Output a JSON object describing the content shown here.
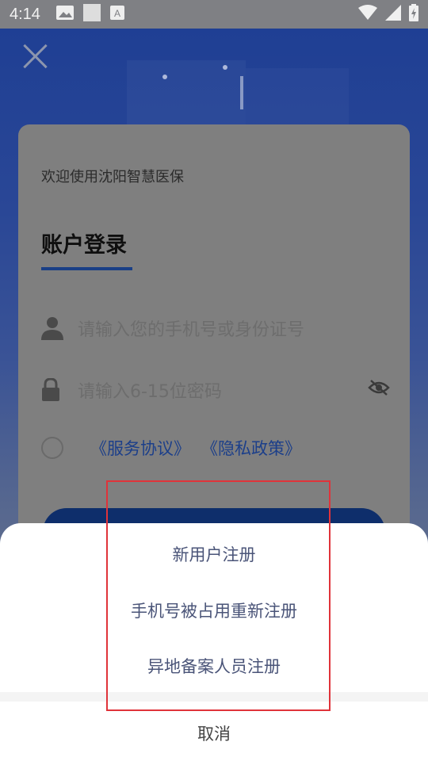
{
  "status_bar": {
    "time": "4:14",
    "icons": [
      "image-icon",
      "square-icon",
      "font-icon",
      "wifi-icon",
      "signal-icon",
      "battery-charging-icon"
    ]
  },
  "login": {
    "welcome": "欢迎使用沈阳智慧医保",
    "tab_label": "账户登录",
    "phone_placeholder": "请输入您的手机号或身份证号",
    "password_placeholder": "请输入6-15位密码",
    "service_agreement": "《服务协议》",
    "privacy_policy": "《隐私政策》"
  },
  "sheet": {
    "items": [
      {
        "label": "新用户注册"
      },
      {
        "label": "手机号被占用重新注册"
      },
      {
        "label": "异地备案人员注册"
      }
    ],
    "cancel": "取消"
  },
  "colors": {
    "accent": "#1a3f86",
    "highlight": "#e0333a"
  }
}
